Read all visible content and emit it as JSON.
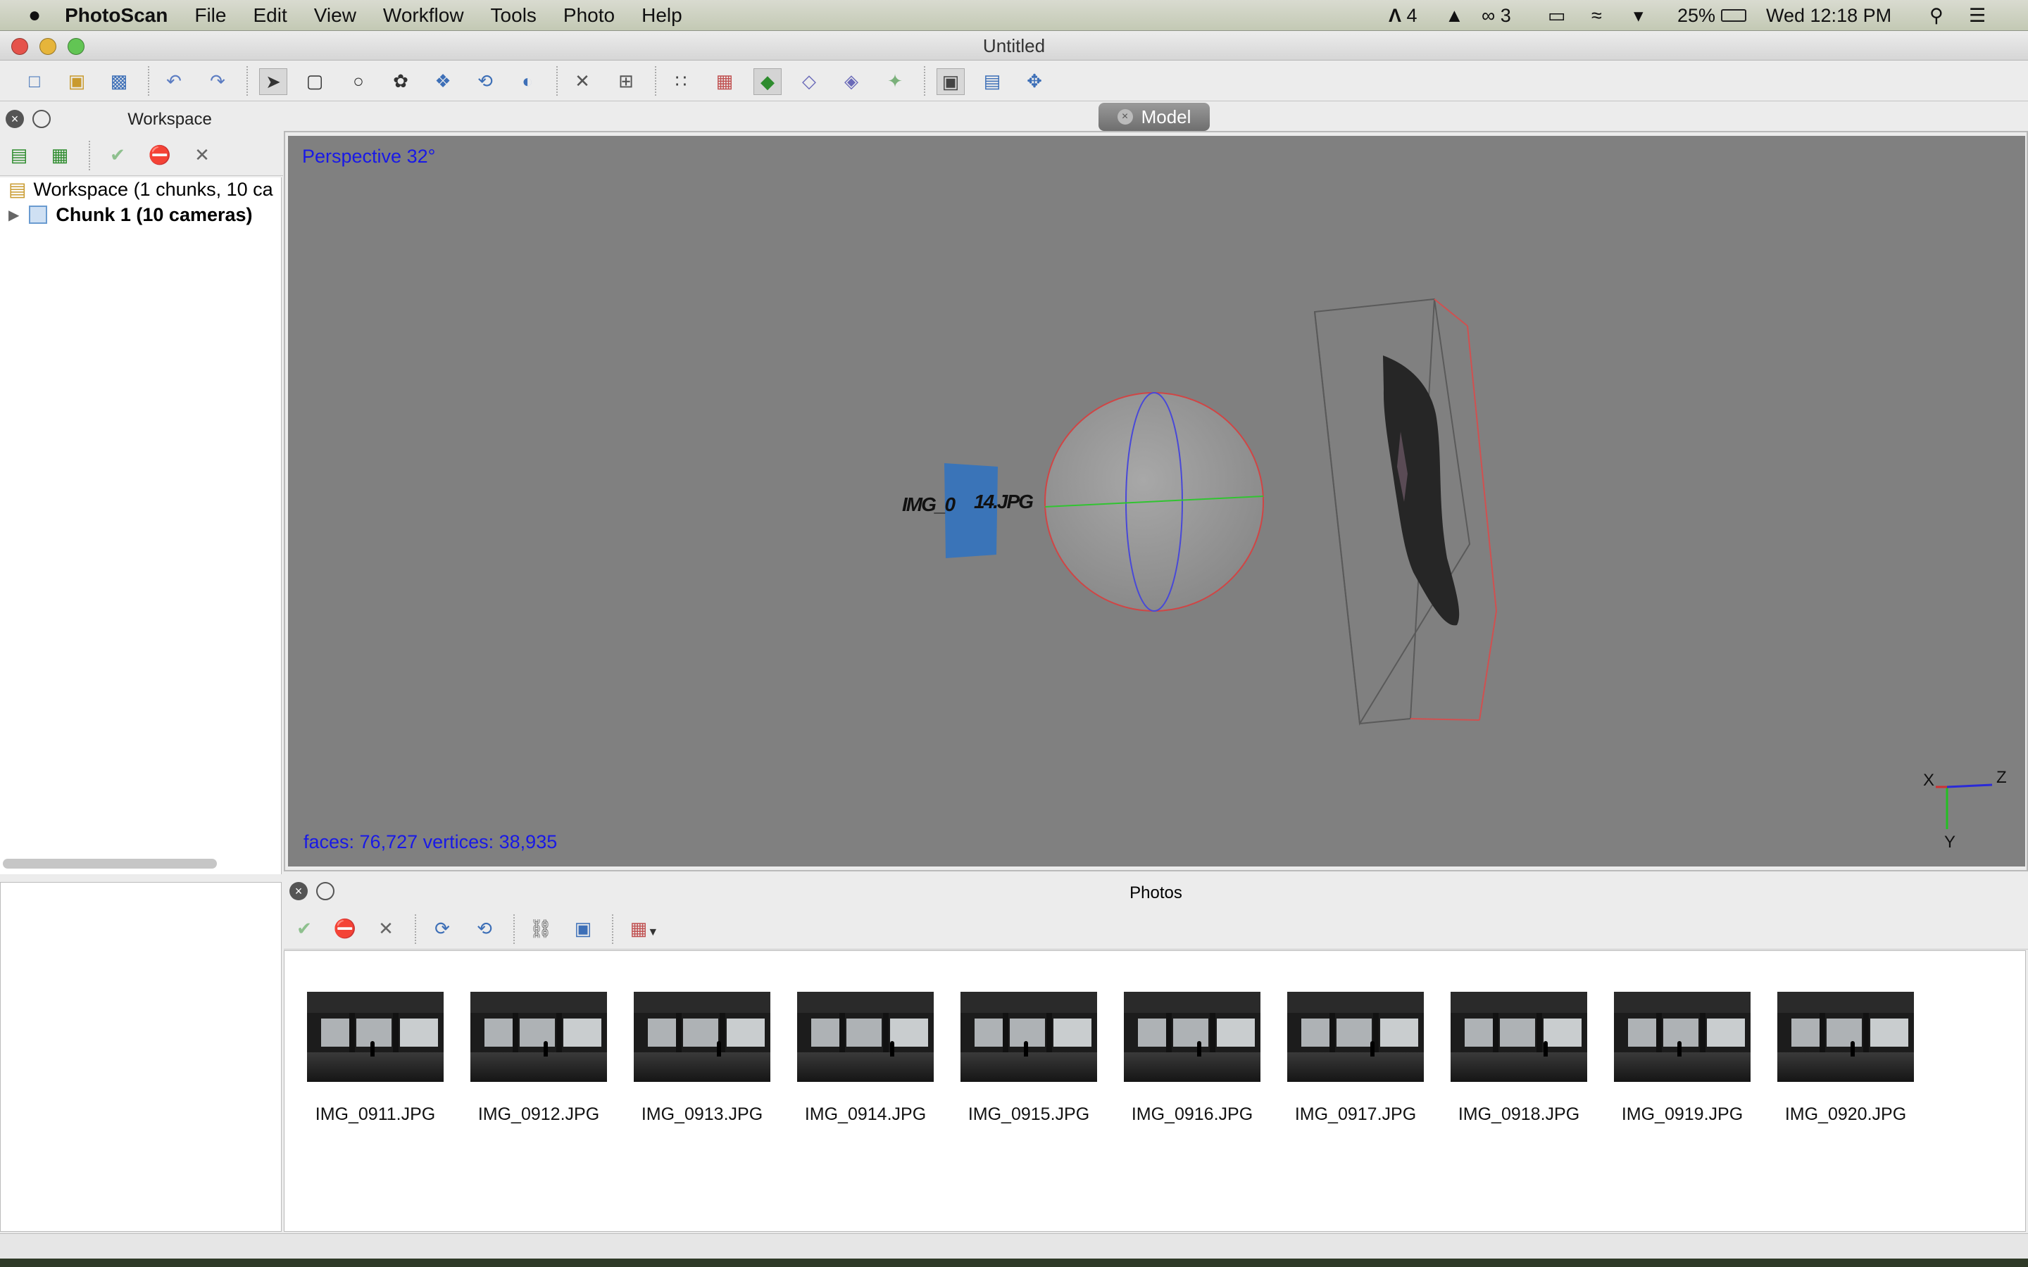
{
  "menubar": {
    "apple": "",
    "app_name": "PhotoScan",
    "items": [
      "File",
      "Edit",
      "View",
      "Workflow",
      "Tools",
      "Photo",
      "Help"
    ],
    "status": {
      "adobe_count": "4",
      "cc_count": "3",
      "battery": "25%",
      "clock": "Wed 12:18 PM"
    }
  },
  "window": {
    "title": "Untitled"
  },
  "workspace": {
    "title": "Workspace",
    "tree": {
      "root": "Workspace (1 chunks, 10 ca",
      "chunk": "Chunk 1 (10 cameras)"
    }
  },
  "model": {
    "tab_label": "Model",
    "perspective": "Perspective 32°",
    "stats": "faces: 76,727 vertices: 38,935",
    "axes": {
      "x": "X",
      "y": "Y",
      "z": "Z"
    },
    "camera_label": "IMG_0",
    "camera_label2": "14.JPG"
  },
  "photos": {
    "title": "Photos",
    "items": [
      "IMG_0911.JPG",
      "IMG_0912.JPG",
      "IMG_0913.JPG",
      "IMG_0914.JPG",
      "IMG_0915.JPG",
      "IMG_0916.JPG",
      "IMG_0917.JPG",
      "IMG_0918.JPG",
      "IMG_0919.JPG",
      "IMG_0920.JPG"
    ]
  },
  "colors": {
    "overlay_text": "#1919e6",
    "viewport_bg": "#808080",
    "camera_plane": "#3a74b8"
  }
}
